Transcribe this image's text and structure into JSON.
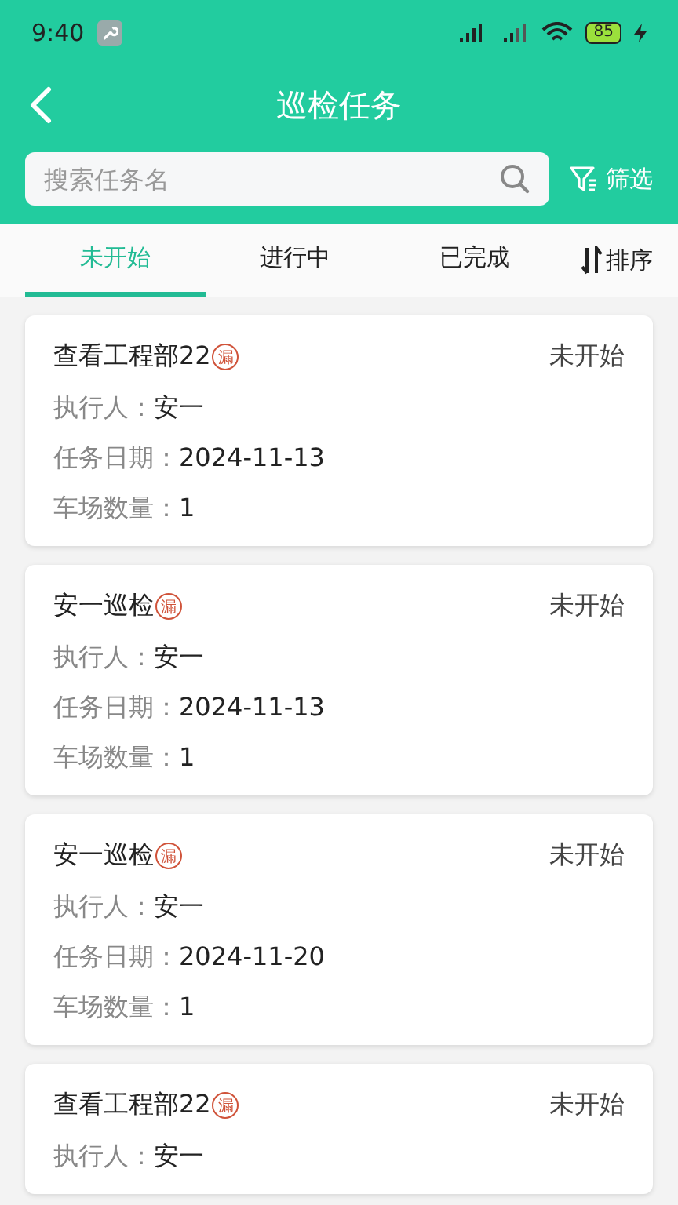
{
  "status_bar": {
    "time": "9:40",
    "battery": "85"
  },
  "header": {
    "title": "巡检任务"
  },
  "search": {
    "placeholder": "搜索任务名"
  },
  "filter": {
    "label": "筛选"
  },
  "tabs": [
    {
      "label": "未开始",
      "selected": true
    },
    {
      "label": "进行中",
      "selected": false
    },
    {
      "label": "已完成",
      "selected": false
    }
  ],
  "sort": {
    "label": "排序"
  },
  "tasks": [
    {
      "title": "查看工程部22",
      "badge": "漏",
      "status": "未开始",
      "fields": [
        {
          "label": "执行人：",
          "value": "安一"
        },
        {
          "label": "任务日期：",
          "value": "2024-11-13"
        },
        {
          "label": "车场数量：",
          "value": "1"
        }
      ]
    },
    {
      "title": "安一巡检",
      "badge": "漏",
      "status": "未开始",
      "fields": [
        {
          "label": "执行人：",
          "value": "安一"
        },
        {
          "label": "任务日期：",
          "value": "2024-11-13"
        },
        {
          "label": "车场数量：",
          "value": "1"
        }
      ]
    },
    {
      "title": "安一巡检",
      "badge": "漏",
      "status": "未开始",
      "fields": [
        {
          "label": "执行人：",
          "value": "安一"
        },
        {
          "label": "任务日期：",
          "value": "2024-11-20"
        },
        {
          "label": "车场数量：",
          "value": "1"
        }
      ]
    },
    {
      "title": "查看工程部22",
      "badge": "漏",
      "status": "未开始",
      "fields": [
        {
          "label": "执行人：",
          "value": "安一"
        }
      ]
    }
  ]
}
